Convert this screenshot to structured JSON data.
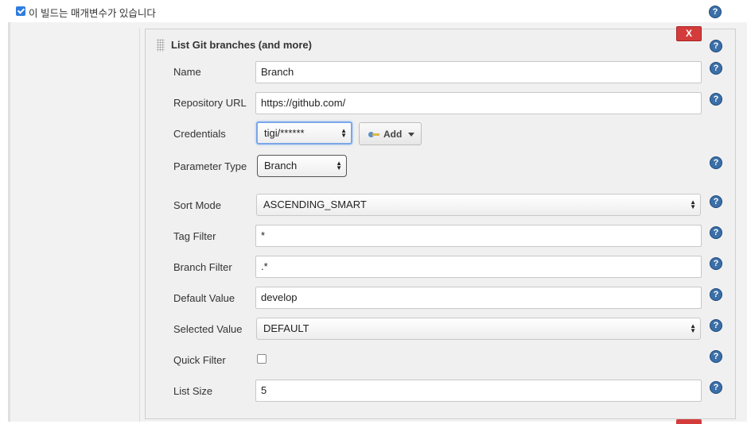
{
  "top": {
    "checkbox_checked": true,
    "label": "이 빌드는 매개변수가 있습니다"
  },
  "panel": {
    "title": "List Git branches (and more)",
    "close_label": "X"
  },
  "fields": {
    "name": {
      "label": "Name",
      "value": "Branch"
    },
    "repository_url": {
      "label": "Repository URL",
      "value": "https://github.com/"
    },
    "credentials": {
      "label": "Credentials",
      "value": "tigi/******",
      "add_label": "Add"
    },
    "parameter_type": {
      "label": "Parameter Type",
      "value": "Branch"
    },
    "sort_mode": {
      "label": "Sort Mode",
      "value": "ASCENDING_SMART"
    },
    "tag_filter": {
      "label": "Tag Filter",
      "value": "*"
    },
    "branch_filter": {
      "label": "Branch Filter",
      "value": ".*"
    },
    "default_value": {
      "label": "Default Value",
      "value": "develop"
    },
    "selected_value": {
      "label": "Selected Value",
      "value": "DEFAULT"
    },
    "quick_filter": {
      "label": "Quick Filter",
      "checked": false
    },
    "list_size": {
      "label": "List Size",
      "value": "5"
    }
  },
  "help_glyph": "?",
  "icons": [
    "help-icon",
    "drag-handle-icon",
    "key-icon",
    "chevron-down-icon",
    "select-arrows-icon",
    "checkbox-checked-icon"
  ],
  "colors": {
    "help": "#3b6fa8",
    "close": "#d43c3c",
    "focus": "#7aa7e8",
    "checkbox": "#2e7de0"
  }
}
